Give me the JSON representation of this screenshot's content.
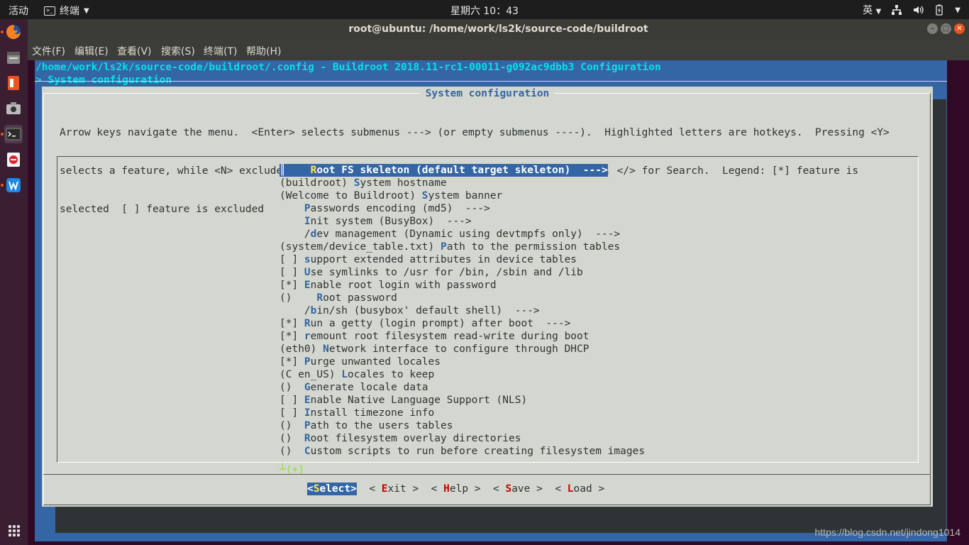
{
  "topbar": {
    "activities": "活动",
    "app_name": "终端",
    "clock": "星期六 10：43",
    "input_method": "英"
  },
  "window": {
    "title": "root@ubuntu: /home/work/ls2k/source-code/buildroot",
    "menu": [
      "文件(F)",
      "编辑(E)",
      "查看(V)",
      "搜索(S)",
      "终端(T)",
      "帮助(H)"
    ]
  },
  "terminal": {
    "config_path": "/home/work/ls2k/source-code/buildroot/.config - Buildroot 2018.11-rc1-00011-g092ac9dbb3 Configuration",
    "breadcrumb": "> System configuration",
    "dialog_title": "System configuration",
    "help_lines": [
      "Arrow keys navigate the menu.  <Enter> selects submenus ---> (or empty submenus ----).  Highlighted letters are hotkeys.  Pressing <Y>",
      "selects a feature, while <N> excludes a feature.  Press <Esc><Esc> to exit, <?> for Help, </> for Search.  Legend: [*] feature is",
      "selected  [ ] feature is excluded"
    ],
    "items": [
      {
        "pre": "    ",
        "hk": "R",
        "post": "oot FS skeleton (default target skeleton)  --->",
        "selected": true
      },
      {
        "pre": "(buildroot) ",
        "hk": "S",
        "post": "ystem hostname"
      },
      {
        "pre": "(Welcome to Buildroot) ",
        "hk": "S",
        "post": "ystem banner"
      },
      {
        "pre": "    ",
        "hk": "P",
        "post": "asswords encoding (md5)  --->"
      },
      {
        "pre": "    ",
        "hk": "I",
        "post": "nit system (BusyBox)  --->"
      },
      {
        "pre": "    /",
        "hk": "d",
        "post": "ev management (Dynamic using devtmpfs only)  --->"
      },
      {
        "pre": "(system/device_table.txt) ",
        "hk": "P",
        "post": "ath to the permission tables"
      },
      {
        "pre": "[ ] ",
        "hk": "s",
        "post": "upport extended attributes in device tables"
      },
      {
        "pre": "[ ] ",
        "hk": "U",
        "post": "se symlinks to /usr for /bin, /sbin and /lib"
      },
      {
        "pre": "[*] ",
        "hk": "E",
        "post": "nable root login with password"
      },
      {
        "pre": "()    ",
        "hk": "R",
        "post": "oot password"
      },
      {
        "pre": "    /",
        "hk": "b",
        "post": "in/sh (busybox' default shell)  --->"
      },
      {
        "pre": "[*] ",
        "hk": "R",
        "post": "un a getty (login prompt) after boot  --->"
      },
      {
        "pre": "[*] ",
        "hk": "r",
        "post": "emount root filesystem read-write during boot"
      },
      {
        "pre": "(eth0) ",
        "hk": "N",
        "post": "etwork interface to configure through DHCP"
      },
      {
        "pre": "[*] ",
        "hk": "P",
        "post": "urge unwanted locales"
      },
      {
        "pre": "(C en_US) ",
        "hk": "L",
        "post": "ocales to keep"
      },
      {
        "pre": "()  ",
        "hk": "G",
        "post": "enerate locale data"
      },
      {
        "pre": "[ ] ",
        "hk": "E",
        "post": "nable Native Language Support (NLS)"
      },
      {
        "pre": "[ ] ",
        "hk": "I",
        "post": "nstall timezone info"
      },
      {
        "pre": "()  ",
        "hk": "P",
        "post": "ath to the users tables"
      },
      {
        "pre": "()  ",
        "hk": "R",
        "post": "oot filesystem overlay directories"
      },
      {
        "pre": "()  ",
        "hk": "C",
        "post": "ustom scripts to run before creating filesystem images"
      }
    ],
    "more_indicator": "(+)",
    "buttons": [
      {
        "lead": "<",
        "key": "S",
        "rest": "elect>",
        "selected": true
      },
      {
        "lead": "< ",
        "key": "E",
        "rest": "xit >"
      },
      {
        "lead": "< ",
        "key": "H",
        "rest": "elp >"
      },
      {
        "lead": "< ",
        "key": "S",
        "rest": "ave >"
      },
      {
        "lead": "< ",
        "key": "L",
        "rest": "oad >"
      }
    ]
  },
  "watermark": "https://blog.csdn.net/jindong1014"
}
